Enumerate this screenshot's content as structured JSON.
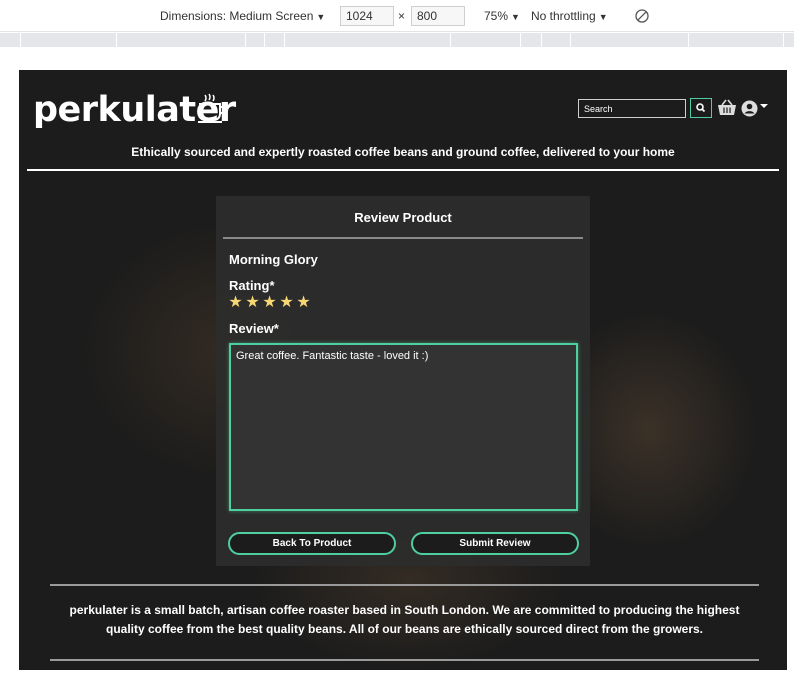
{
  "devtools": {
    "dimensions_label": "Dimensions: Medium Screen",
    "width": "1024",
    "times": "×",
    "height": "800",
    "zoom": "75%",
    "throttling": "No throttling"
  },
  "site": {
    "logo_text": "perkulater",
    "search_placeholder": "Search",
    "tagline": "Ethically sourced and expertly roasted coffee beans and ground coffee, delivered to your home"
  },
  "review": {
    "title": "Review Product",
    "product_name": "Morning Glory",
    "rating_label": "Rating*",
    "rating_value": 5,
    "rating_max": 5,
    "review_label": "Review*",
    "review_text": "Great coffee. Fantastic taste - loved it :)",
    "back_button": "Back To Product",
    "submit_button": "Submit Review"
  },
  "footer": {
    "text": "perkulater is a small batch, artisan coffee roaster based in South London. We are committed to producing the highest quality coffee from the best quality beans. All of our beans are ethically sourced direct from the growers."
  },
  "colors": {
    "accent": "#4ecf9f",
    "star": "#f7d774",
    "background": "#1c1c1c"
  }
}
